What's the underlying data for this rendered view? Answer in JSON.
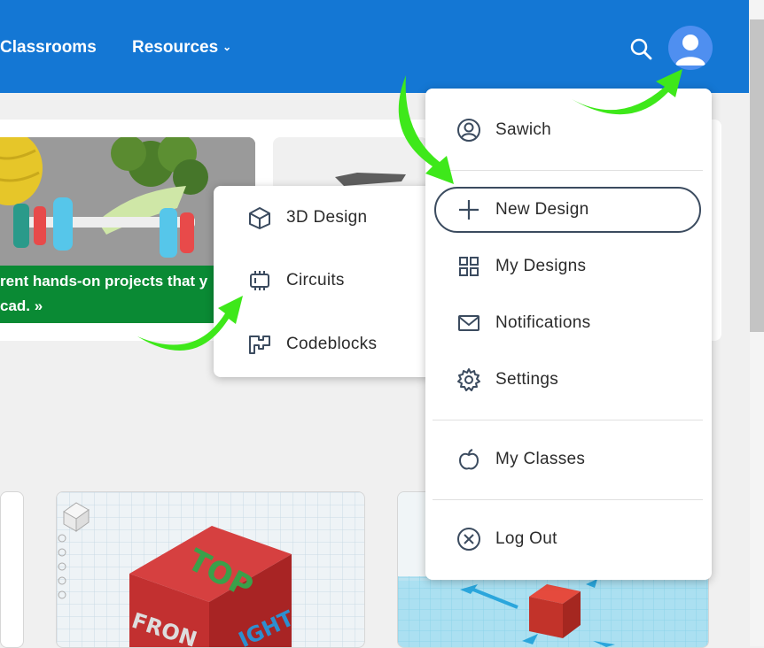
{
  "nav": {
    "classrooms": "Classrooms",
    "resources": "Resources"
  },
  "hero": {
    "caption_line1": "rent hands-on projects that y",
    "caption_line2": "cad. »"
  },
  "submenu": {
    "items": [
      {
        "label": "3D Design",
        "icon": "cube-icon"
      },
      {
        "label": "Circuits",
        "icon": "chip-icon"
      },
      {
        "label": "Codeblocks",
        "icon": "codeblocks-icon"
      }
    ]
  },
  "user_menu": {
    "username": "Sawich",
    "items": [
      {
        "label": "New Design",
        "icon": "plus-icon"
      },
      {
        "label": "My Designs",
        "icon": "grid-icon"
      },
      {
        "label": "Notifications",
        "icon": "mail-icon"
      },
      {
        "label": "Settings",
        "icon": "gear-icon"
      },
      {
        "label": "My Classes",
        "icon": "apple-icon"
      },
      {
        "label": "Log Out",
        "icon": "logout-icon"
      }
    ]
  },
  "design_cards": {
    "cube_top": "TOP",
    "cube_front": "FRON",
    "cube_right": "IGHT"
  },
  "colors": {
    "nav": "#1477d4",
    "hero_caption": "#0a8a34",
    "arrow": "#3ee81a",
    "text": "#2b2b2b"
  }
}
